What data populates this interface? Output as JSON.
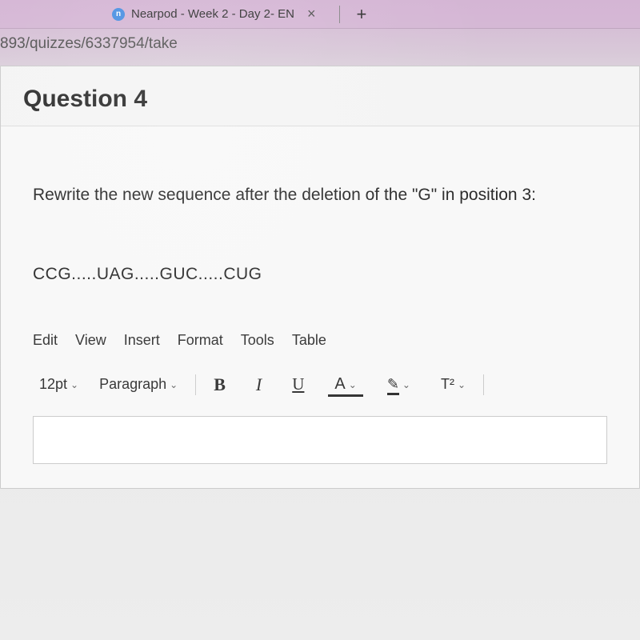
{
  "browser": {
    "tab_title": "Nearpod - Week 2 - Day 2- EN",
    "url_fragment": "893/quizzes/6337954/take"
  },
  "question": {
    "heading": "Question 4",
    "prompt": "Rewrite the new sequence after the deletion of the \"G\" in position 3:",
    "sequence": "CCG.....UAG.....GUC.....CUG"
  },
  "editor": {
    "menu": {
      "edit": "Edit",
      "view": "View",
      "insert": "Insert",
      "format": "Format",
      "tools": "Tools",
      "table": "Table"
    },
    "toolbar": {
      "font_size": "12pt",
      "block_format": "Paragraph",
      "bold": "B",
      "italic": "I",
      "underline": "U",
      "text_color": "A",
      "highlight": "✎",
      "superscript": "T²"
    }
  }
}
